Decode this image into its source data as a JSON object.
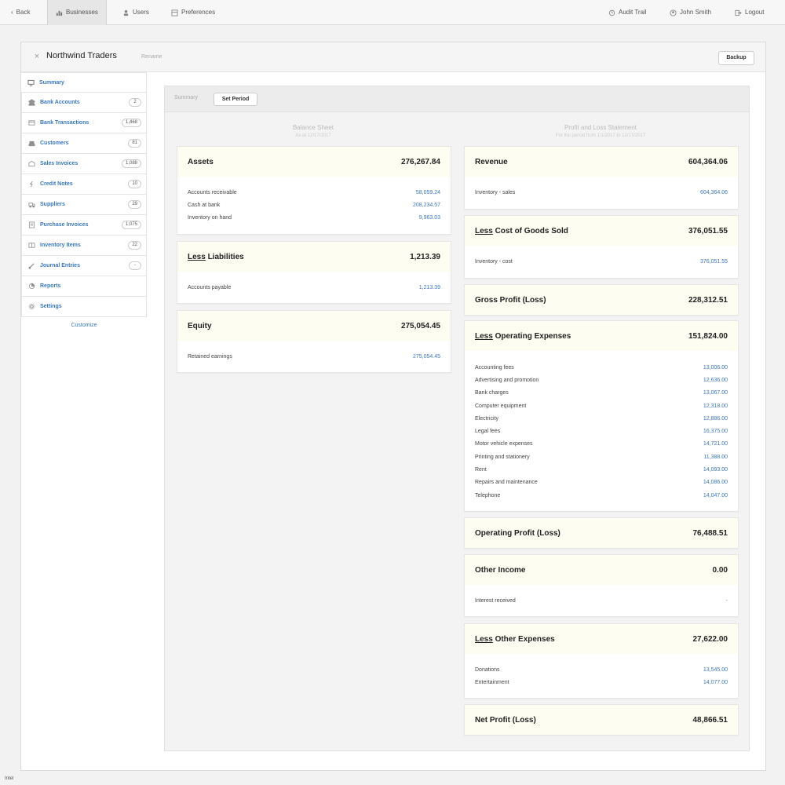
{
  "nav": {
    "back": "Back",
    "businesses": "Businesses",
    "users": "Users",
    "preferences": "Preferences",
    "audit_trail": "Audit Trail",
    "user_name": "John Smith",
    "logout": "Logout"
  },
  "header": {
    "business_name": "Northwind Traders",
    "rename": "Rename",
    "backup": "Backup"
  },
  "sidebar": {
    "items": [
      {
        "label": "Summary",
        "count": "",
        "icon": "monitor-icon"
      },
      {
        "label": "Bank Accounts",
        "count": "2",
        "icon": "bank-icon"
      },
      {
        "label": "Bank Transactions",
        "count": "1,468",
        "icon": "transactions-icon"
      },
      {
        "label": "Customers",
        "count": "81",
        "icon": "customers-icon"
      },
      {
        "label": "Sales Invoices",
        "count": "1,088",
        "icon": "sales-invoice-icon"
      },
      {
        "label": "Credit Notes",
        "count": "10",
        "icon": "credit-note-icon"
      },
      {
        "label": "Suppliers",
        "count": "29",
        "icon": "suppliers-icon"
      },
      {
        "label": "Purchase Invoices",
        "count": "1,075",
        "icon": "purchase-invoice-icon"
      },
      {
        "label": "Inventory Items",
        "count": "22",
        "icon": "inventory-icon"
      },
      {
        "label": "Journal Entries",
        "count": "-",
        "icon": "journal-icon"
      },
      {
        "label": "Reports",
        "count": "",
        "icon": "reports-icon"
      },
      {
        "label": "Settings",
        "count": "",
        "icon": "settings-icon"
      }
    ],
    "customize": "Customize"
  },
  "tabs": {
    "summary": "Summary",
    "set_period": "Set Period"
  },
  "balance_sheet": {
    "title": "Balance Sheet",
    "subtitle": "As at 12/17/2017",
    "assets": {
      "title": "Assets",
      "total": "276,267.84",
      "rows": [
        {
          "label": "Accounts receivable",
          "value": "58,059.24"
        },
        {
          "label": "Cash at bank",
          "value": "208,234.57"
        },
        {
          "label": "Inventory on hand",
          "value": "9,963.03"
        }
      ]
    },
    "liabilities": {
      "less": "Less",
      "title": "Liabilities",
      "total": "1,213.39",
      "rows": [
        {
          "label": "Accounts payable",
          "value": "1,213.39"
        }
      ]
    },
    "equity": {
      "title": "Equity",
      "total": "275,054.45",
      "rows": [
        {
          "label": "Retained earnings",
          "value": "275,054.45"
        }
      ]
    }
  },
  "pnl": {
    "title": "Profit and Loss Statement",
    "subtitle": "For the period from 1/1/2017 to 12/17/2017",
    "revenue": {
      "title": "Revenue",
      "total": "604,364.06",
      "rows": [
        {
          "label": "Inventory - sales",
          "value": "604,364.06"
        }
      ]
    },
    "cogs": {
      "less": "Less",
      "title": "Cost of Goods Sold",
      "total": "376,051.55",
      "rows": [
        {
          "label": "Inventory - cost",
          "value": "376,051.55"
        }
      ]
    },
    "gross_profit": {
      "title": "Gross Profit (Loss)",
      "total": "228,312.51"
    },
    "operating_expenses": {
      "less": "Less",
      "title": "Operating Expenses",
      "total": "151,824.00",
      "rows": [
        {
          "label": "Accounting fees",
          "value": "13,006.00"
        },
        {
          "label": "Advertising and promotion",
          "value": "12,636.00"
        },
        {
          "label": "Bank charges",
          "value": "13,067.00"
        },
        {
          "label": "Computer equipment",
          "value": "12,318.00"
        },
        {
          "label": "Electricity",
          "value": "12,886.00"
        },
        {
          "label": "Legal fees",
          "value": "16,375.00"
        },
        {
          "label": "Motor vehicle expenses",
          "value": "14,721.00"
        },
        {
          "label": "Printing and stationery",
          "value": "11,388.00"
        },
        {
          "label": "Rent",
          "value": "14,093.00"
        },
        {
          "label": "Repairs and maintenance",
          "value": "14,086.00"
        },
        {
          "label": "Telephone",
          "value": "14,047.00"
        }
      ]
    },
    "operating_profit": {
      "title": "Operating Profit (Loss)",
      "total": "76,488.51"
    },
    "other_income": {
      "title": "Other Income",
      "total": "0.00",
      "rows": [
        {
          "label": "Interest received",
          "value": "-"
        }
      ]
    },
    "other_expenses": {
      "less": "Less",
      "title": "Other Expenses",
      "total": "27,622.00",
      "rows": [
        {
          "label": "Donations",
          "value": "13,545.00"
        },
        {
          "label": "Entertainment",
          "value": "14,077.00"
        }
      ]
    },
    "net_profit": {
      "title": "Net Profit (Loss)",
      "total": "48,866.51"
    }
  },
  "status_bar": {
    "text": "Intel"
  },
  "colors": {
    "link": "#3a78c2",
    "card_header_bg": "#fdfdf2",
    "page_bg": "#f2f2f2"
  }
}
